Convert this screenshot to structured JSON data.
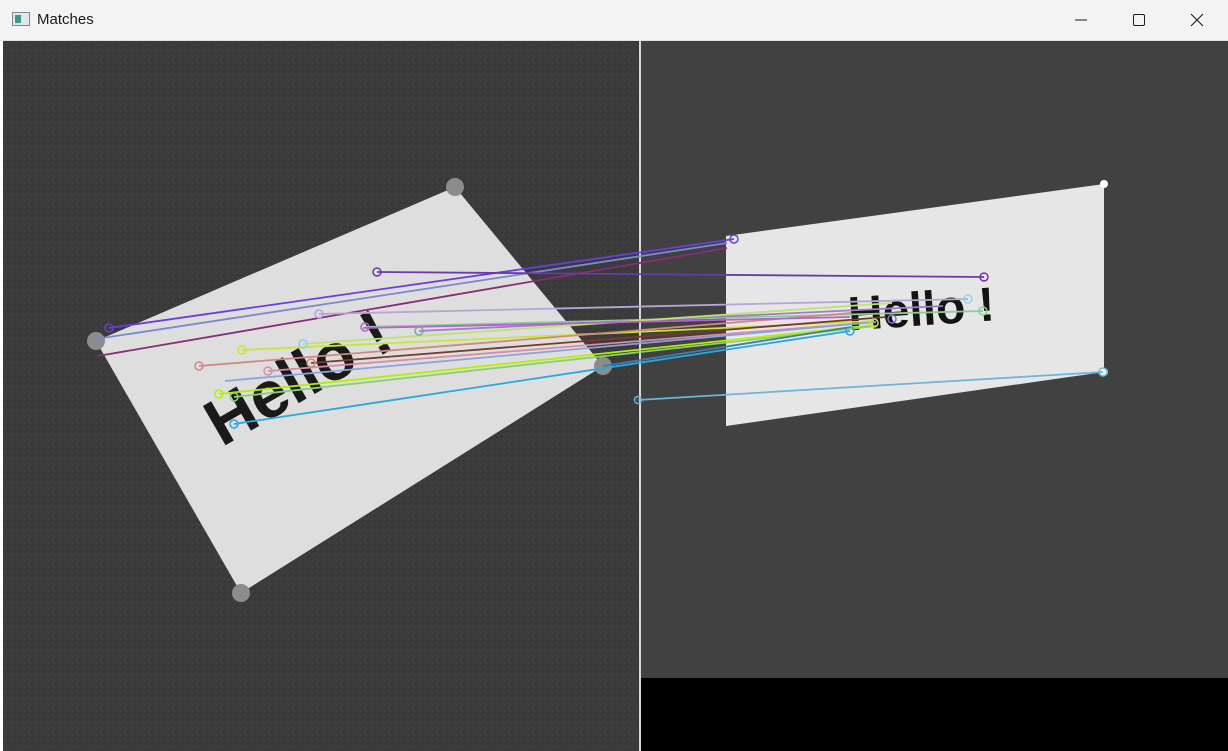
{
  "window": {
    "title": "Matches",
    "controls": {
      "minimize": "minimize-icon",
      "maximize": "maximize-icon",
      "close": "close-icon"
    }
  },
  "image": {
    "description_left": "grayscale photo of a tilted card with handwritten text",
    "card_text": "Hello !",
    "right_text": "Hello !",
    "colors": {
      "left_bg": "#3a3a3a",
      "right_bg": "#414141",
      "card": "#e6e6e6",
      "divider": "#d9d9d9"
    }
  }
}
